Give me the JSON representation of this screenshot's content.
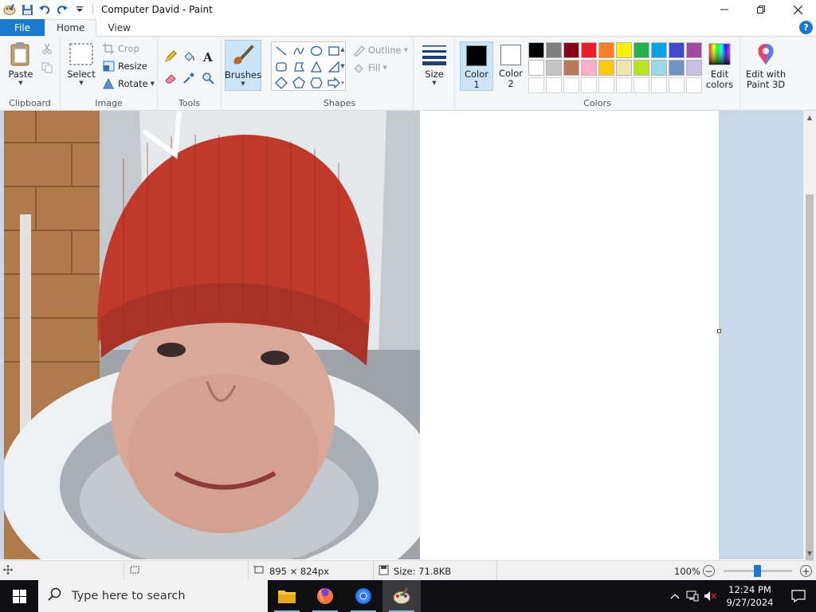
{
  "window": {
    "title": "Computer David - Paint",
    "controls": [
      "minimize",
      "maximize",
      "close"
    ]
  },
  "quick_access": {
    "items": [
      "paint-app-icon",
      "save-icon",
      "undo-icon",
      "redo-icon",
      "customize-dropdown-icon"
    ]
  },
  "ribbon_tabs": {
    "file": "File",
    "home": "Home",
    "view": "View",
    "active": "Home"
  },
  "clipboard": {
    "label": "Clipboard",
    "paste": "Paste"
  },
  "image": {
    "label": "Image",
    "select": "Select",
    "crop": "Crop",
    "resize": "Resize",
    "rotate": "Rotate"
  },
  "tools": {
    "label": "Tools",
    "items": [
      "pencil-icon",
      "fill-bucket-icon",
      "text-icon",
      "eraser-icon",
      "color-picker-icon",
      "magnifier-icon"
    ]
  },
  "brushes": {
    "label": "Brushes"
  },
  "shapes": {
    "label": "Shapes",
    "outline": "Outline",
    "fill": "Fill",
    "items": [
      "line",
      "curve",
      "oval",
      "rectangle",
      "rounded-rectangle",
      "polygon",
      "triangle",
      "right-triangle",
      "diamond",
      "pentagon",
      "hexagon",
      "right-arrow"
    ]
  },
  "size": {
    "label": "Size"
  },
  "colors": {
    "label": "Colors",
    "color1_line1": "Color",
    "color1_line2": "1",
    "color2_line1": "Color",
    "color2_line2": "2",
    "color1_value": "#000000",
    "color2_value": "#ffffff",
    "edit_colors_line1": "Edit",
    "edit_colors_line2": "colors",
    "edit_paint3d_line1": "Edit with",
    "edit_paint3d_line2": "Paint 3D",
    "palette_row1": [
      "#000000",
      "#7f7f7f",
      "#880015",
      "#ed1c24",
      "#ff7f27",
      "#fff200",
      "#22b14c",
      "#00a2e8",
      "#3f48cc",
      "#a349a4"
    ],
    "palette_row2": [
      "#ffffff",
      "#c3c3c3",
      "#b97a57",
      "#ffaec9",
      "#ffc90e",
      "#efe4b0",
      "#b5e61d",
      "#99d9ea",
      "#7092be",
      "#c8bfe7"
    ]
  },
  "canvas": {
    "content": "photo of a child wearing a red knit beanie, head in a white toilet bowl"
  },
  "status": {
    "dimensions": "895 × 824px",
    "size": "Size: 71.8KB",
    "zoom": "100%",
    "zoom_level": 1.0
  },
  "taskbar": {
    "search_placeholder": "Type here to search",
    "apps": [
      "file-explorer",
      "firefox",
      "chrome",
      "paint"
    ],
    "time": "12:24 PM",
    "date": "9/27/2024"
  }
}
